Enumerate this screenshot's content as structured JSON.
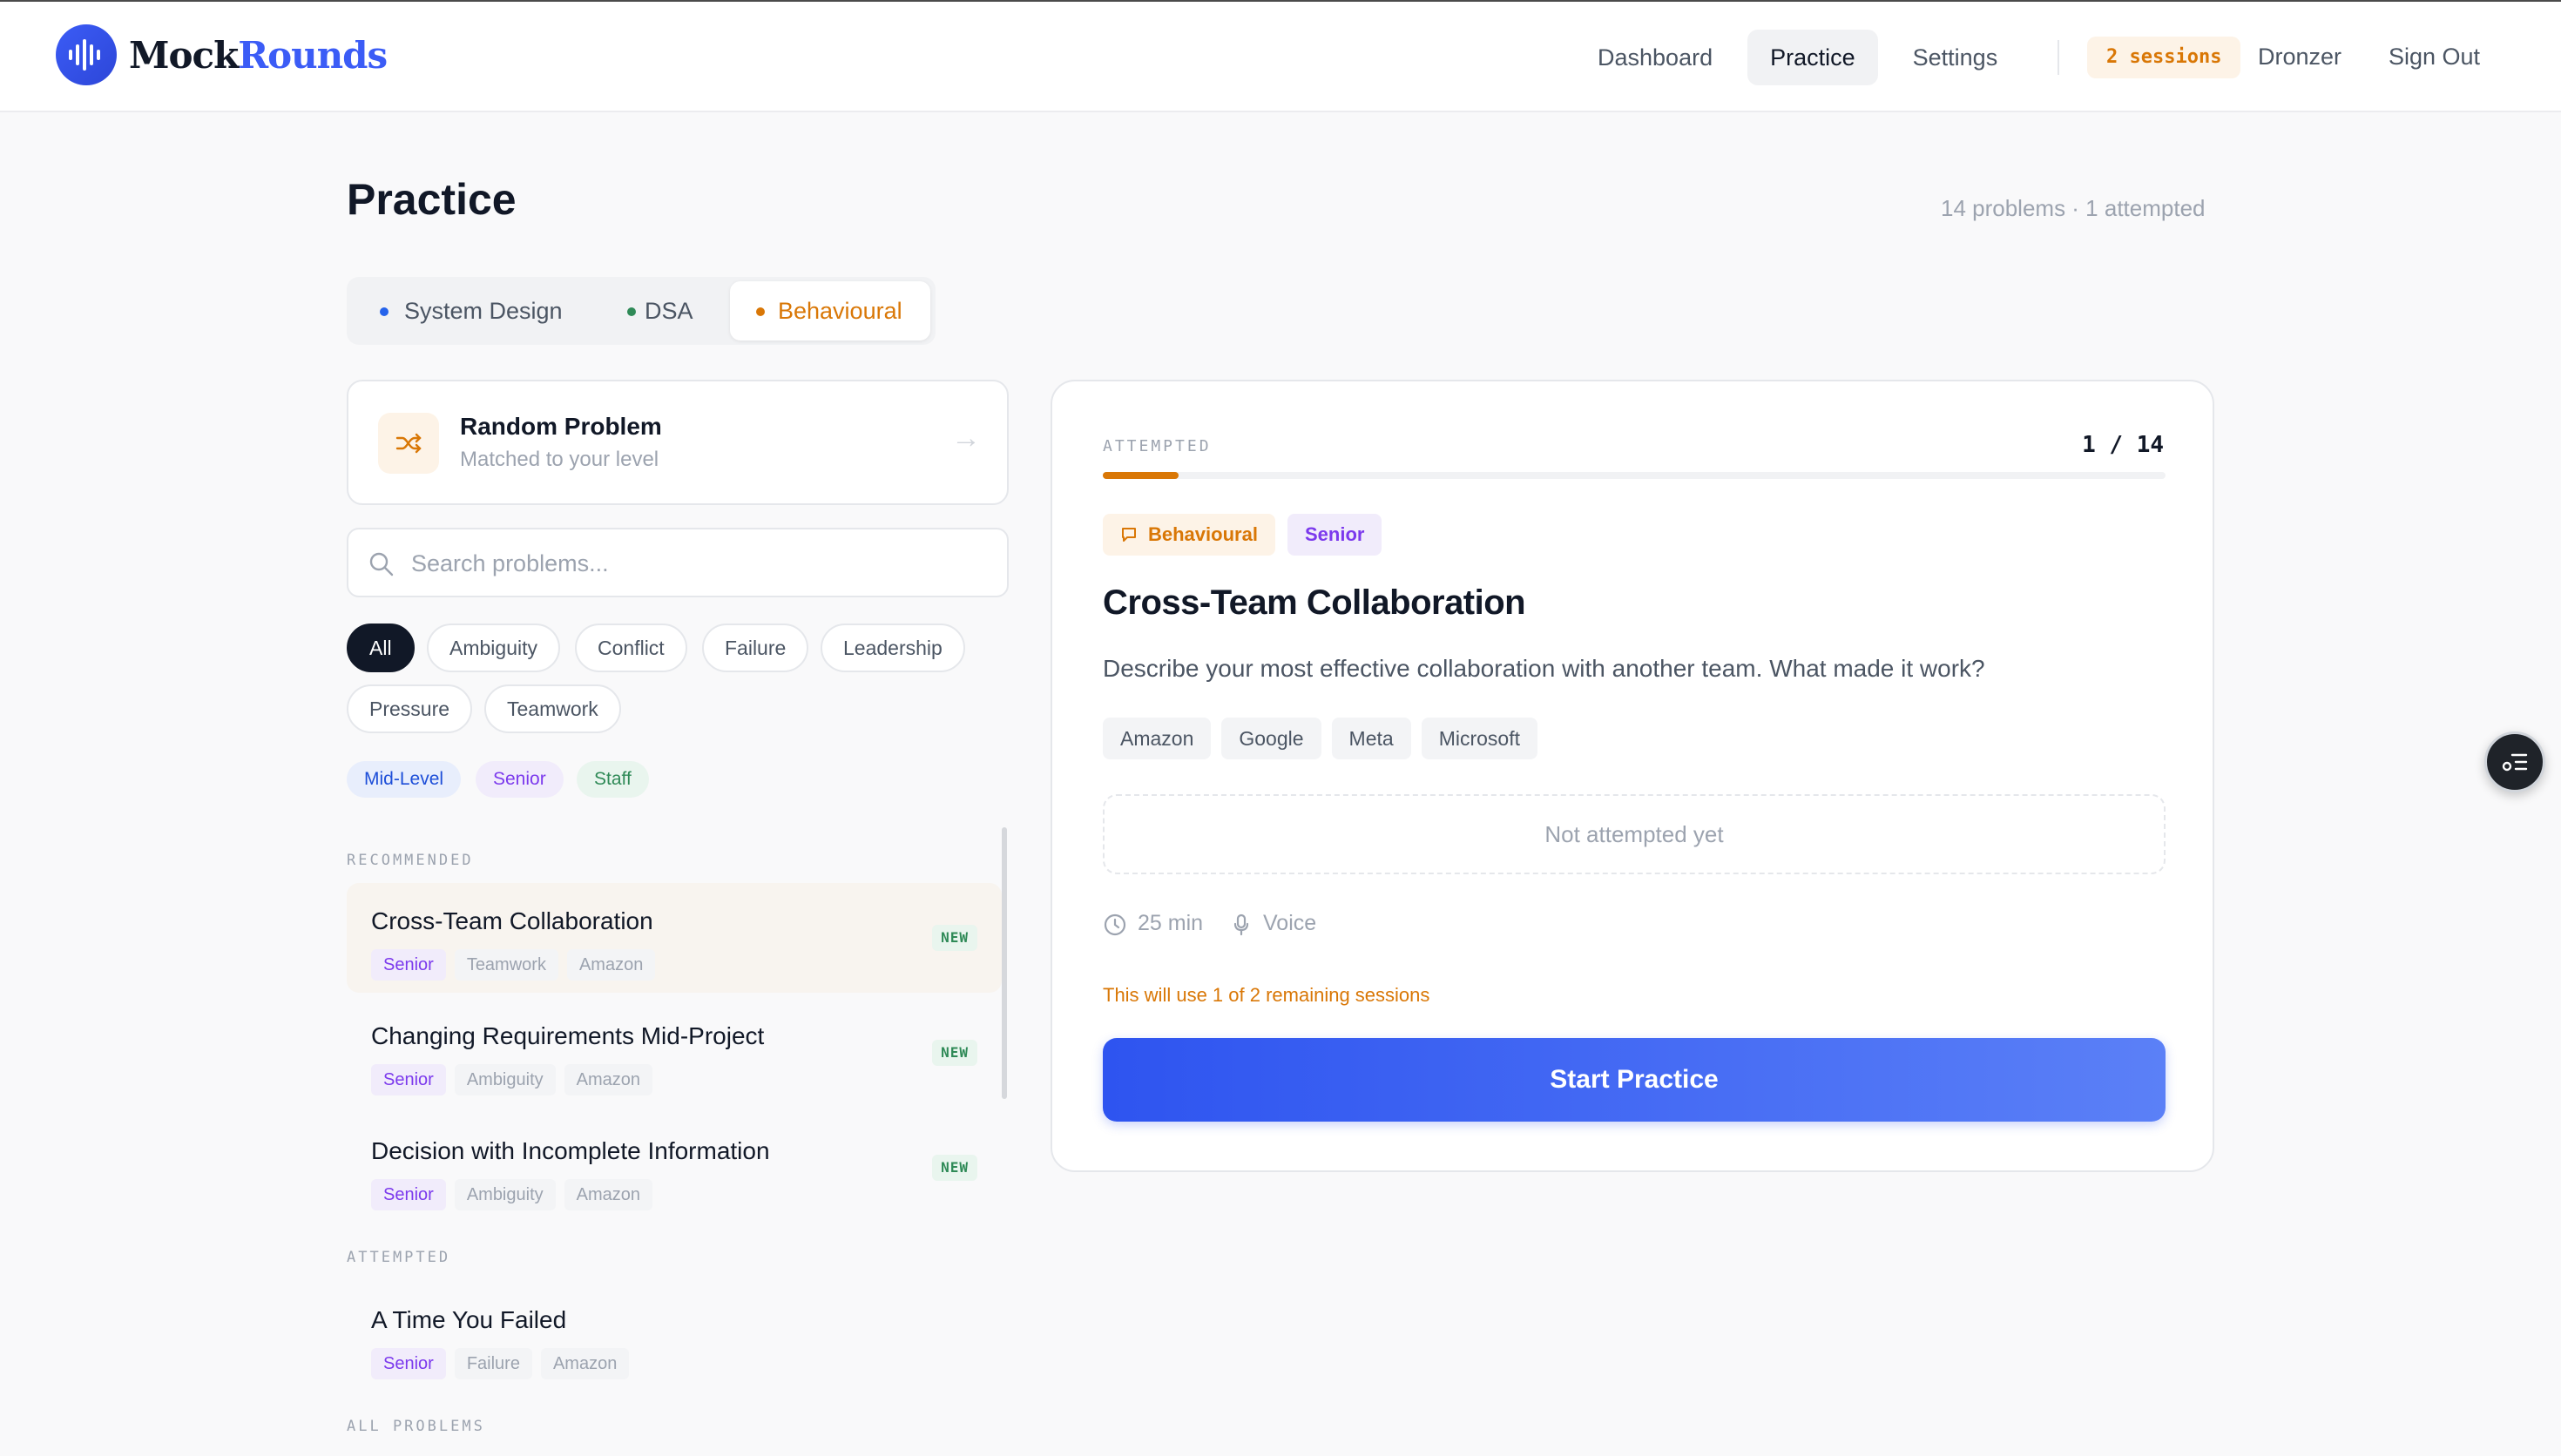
{
  "app": {
    "logo_prefix": "Mock",
    "logo_accent": "Rounds",
    "accent_color": "#3b5cf6",
    "behavioural_color": "#d97706"
  },
  "nav": {
    "items": [
      {
        "label": "Dashboard"
      },
      {
        "label": "Practice"
      },
      {
        "label": "Settings"
      }
    ],
    "sessions_badge": "2 sessions",
    "user_name": "Dronzer",
    "sign_out": "Sign Out"
  },
  "page": {
    "title": "Practice",
    "count": "14 problems · 1 attempted"
  },
  "tabs": [
    {
      "label": "System Design",
      "color": "#2563eb"
    },
    {
      "label": "DSA",
      "color": "#2f8a57"
    },
    {
      "label": "Behavioural",
      "color": "#d97706"
    }
  ],
  "random": {
    "title": "Random Problem",
    "subtitle": "Matched to your level",
    "arrow": "→"
  },
  "search": {
    "placeholder": "Search problems...",
    "value": ""
  },
  "categories": [
    "All",
    "Ambiguity",
    "Conflict",
    "Failure",
    "Leadership",
    "Pressure",
    "Teamwork"
  ],
  "levels": [
    {
      "label": "Mid-Level",
      "color": "#1d4ed8",
      "bg": "#e8eefc"
    },
    {
      "label": "Senior",
      "color": "#7c3aed",
      "bg": "#f1ecfb"
    },
    {
      "label": "Staff",
      "color": "#2f8a57",
      "bg": "#e9f5ee"
    }
  ],
  "sections": {
    "recommended": "RECOMMENDED",
    "attempted": "ATTEMPTED",
    "all": "ALL PROBLEMS"
  },
  "recommended": [
    {
      "title": "Cross-Team Collaboration",
      "level": "Senior",
      "category": "Teamwork",
      "company": "Amazon",
      "badge": "NEW"
    },
    {
      "title": "Changing Requirements Mid-Project",
      "level": "Senior",
      "category": "Ambiguity",
      "company": "Amazon",
      "badge": "NEW"
    },
    {
      "title": "Decision with Incomplete Information",
      "level": "Senior",
      "category": "Ambiguity",
      "company": "Amazon",
      "badge": "NEW"
    }
  ],
  "attempted": [
    {
      "title": "A Time You Failed",
      "level": "Senior",
      "category": "Failure",
      "company": "Amazon"
    }
  ],
  "detail": {
    "status": "ATTEMPTED",
    "counter": "1 / 14",
    "progress_fraction": 0.0714,
    "type": "Behavioural",
    "level": "Senior",
    "title": "Cross-Team Collaboration",
    "description": "Describe your most effective collaboration with another team. What made it work?",
    "companies": [
      "Amazon",
      "Google",
      "Meta",
      "Microsoft"
    ],
    "attempt_status": "Not attempted yet",
    "duration": "25 min",
    "mode": "Voice",
    "warning": "This will use 1 of 2 remaining sessions",
    "start_label": "Start Practice"
  }
}
